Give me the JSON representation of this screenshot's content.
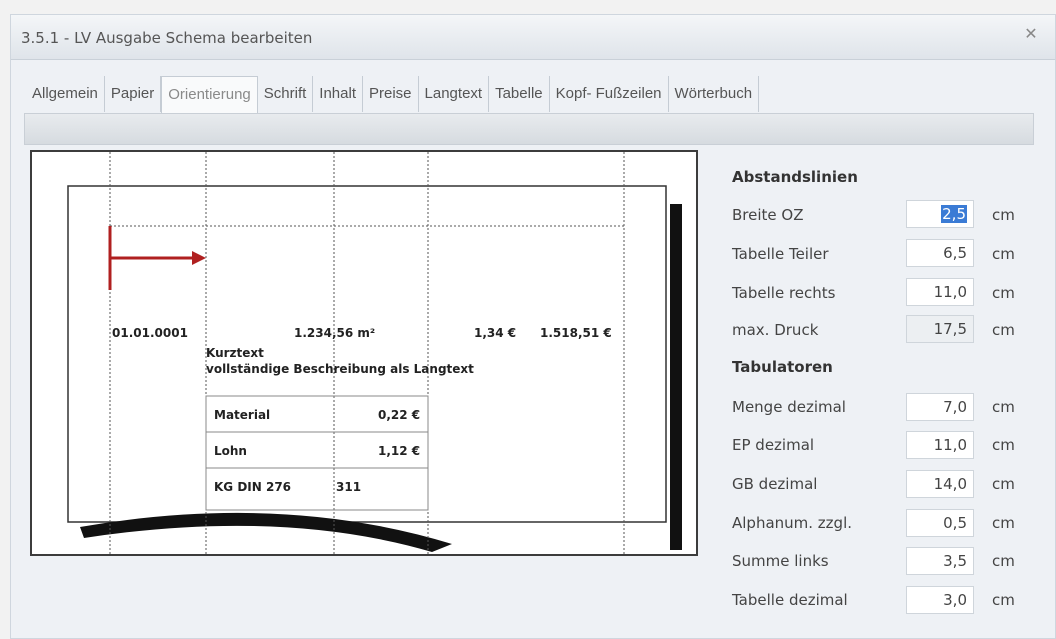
{
  "window": {
    "title": "3.5.1 - LV Ausgabe Schema bearbeiten",
    "close_glyph": "✕"
  },
  "tabs": [
    {
      "label": "Allgemein"
    },
    {
      "label": "Papier"
    },
    {
      "label": "Orientierung"
    },
    {
      "label": "Schrift"
    },
    {
      "label": "Inhalt"
    },
    {
      "label": "Preise"
    },
    {
      "label": "Langtext"
    },
    {
      "label": "Tabelle"
    },
    {
      "label": "Kopf- Fußzeilen"
    },
    {
      "label": "Wörterbuch"
    }
  ],
  "active_tab": "Orientierung",
  "preview": {
    "oz": "01.01.0001",
    "menge": "1.234,56 m²",
    "ep": "1,34 €",
    "gb": "1.518,51 €",
    "kurztext": "Kurztext",
    "langtext": "vollständige Beschreibung als Langtext",
    "table": [
      {
        "label": "Material",
        "value": "0,22 €"
      },
      {
        "label": "Lohn",
        "value": "1,12 €"
      },
      {
        "label": "KG DIN 276",
        "value": "311"
      }
    ]
  },
  "abstandslinien": {
    "heading": "Abstandslinien",
    "rows": [
      {
        "label": "Breite OZ",
        "value": "2,5",
        "unit": "cm"
      },
      {
        "label": "Tabelle Teiler",
        "value": "6,5",
        "unit": "cm"
      },
      {
        "label": "Tabelle rechts",
        "value": "11,0",
        "unit": "cm"
      },
      {
        "label": "max. Druck",
        "value": "17,5",
        "unit": "cm"
      }
    ]
  },
  "tabulatoren": {
    "heading": "Tabulatoren",
    "rows": [
      {
        "label": "Menge dezimal",
        "value": "7,0",
        "unit": "cm"
      },
      {
        "label": "EP dezimal",
        "value": "11,0",
        "unit": "cm"
      },
      {
        "label": "GB dezimal",
        "value": "14,0",
        "unit": "cm"
      },
      {
        "label": "Alphanum. zzgl.",
        "value": "0,5",
        "unit": "cm"
      },
      {
        "label": "Summe links",
        "value": "3,5",
        "unit": "cm"
      },
      {
        "label": "Tabelle dezimal",
        "value": "3,0",
        "unit": "cm"
      }
    ]
  }
}
